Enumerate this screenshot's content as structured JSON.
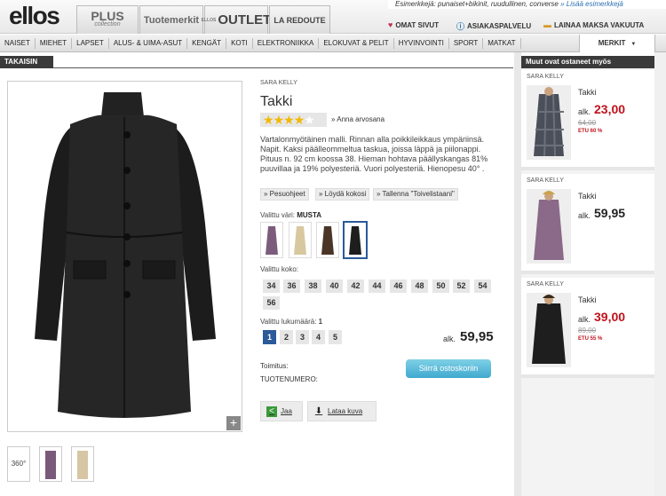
{
  "header": {
    "logo": "ellos",
    "tabs": {
      "plus_main": "PLUS",
      "plus_sub": "collection",
      "tuotemerkit": "Tuotemerkit",
      "outlet_small": "ELLOS",
      "outlet": "OUTLET",
      "redoute": "LA REDOUTE"
    },
    "search_hint_text": "Esimerkkejä: punaiset+bikinit, ruudullinen, converse",
    "search_hint_link": "» Lisää esimerkkejä",
    "links": {
      "omat_sivut": "OMAT SIVUT",
      "asiakaspalvelu": "ASIAKASPALVELU",
      "lainaa": "LAINAA MAKSA VAKUUTA"
    }
  },
  "nav": {
    "items": [
      "NAISET",
      "MIEHET",
      "LAPSET",
      "ALUS- & UIMA-ASUT",
      "KENGÄT",
      "KOTI",
      "ELEKTRONIIKKA",
      "ELOKUVAT & PELIT",
      "HYVINVOINTI",
      "SPORT",
      "MATKAT"
    ],
    "merkit": "MERKIT"
  },
  "back_label": "TAKAISIN",
  "product": {
    "brand": "SARA KELLY",
    "title": "Takki",
    "rate_link": "» Anna arvosana",
    "rating_stars": 4,
    "description": "Vartalonmyötäinen malli. Rinnan alla poikkileikkaus ympäriinsä. Napit. Kaksi päälleommeltua taskua, joissa läppä ja piilonappi. Pituus n. 92 cm koossa 38. Hieman hohtava päällyskangas 81% puuvillaa ja 19% polyesteriä. Vuori polyesteriä. Hienopesu 40°  .",
    "actions": [
      "» Pesuohjeet",
      "» Löydä kokosi",
      "» Tallenna \"Toivelistaani\""
    ],
    "color_label": "Valittu väri:",
    "color_value": "MUSTA",
    "size_label": "Valittu koko:",
    "sizes": [
      "34",
      "36",
      "38",
      "40",
      "42",
      "44",
      "46",
      "48",
      "50",
      "52",
      "54",
      "56"
    ],
    "qty_label": "Valittu lukumäärä:",
    "qty_value": "1",
    "quantities": [
      "1",
      "2",
      "3",
      "4",
      "5"
    ],
    "price_prefix": "alk.",
    "price": "59,95",
    "toimitus": "Toimitus:",
    "tuotenumero": "TUOTENUMERO:",
    "cart_button": "Siirrä ostoskoriin",
    "share": "Jaa",
    "download": "Lataa kuva",
    "thumb_360": "360°"
  },
  "sidebar": {
    "heading": "Muut ovat ostaneet myös",
    "items": [
      {
        "brand": "SARA KELLY",
        "title": "Takki",
        "alk": "alk.",
        "price": "23,00",
        "old": "64,00",
        "discount": "ETU 60 %"
      },
      {
        "brand": "SARA KELLY",
        "title": "Takki",
        "alk": "alk.",
        "price": "59,95"
      },
      {
        "brand": "SARA KELLY",
        "title": "Takki",
        "alk": "alk.",
        "price": "39,00",
        "old": "89,00",
        "discount": "ETU 55 %"
      }
    ]
  }
}
